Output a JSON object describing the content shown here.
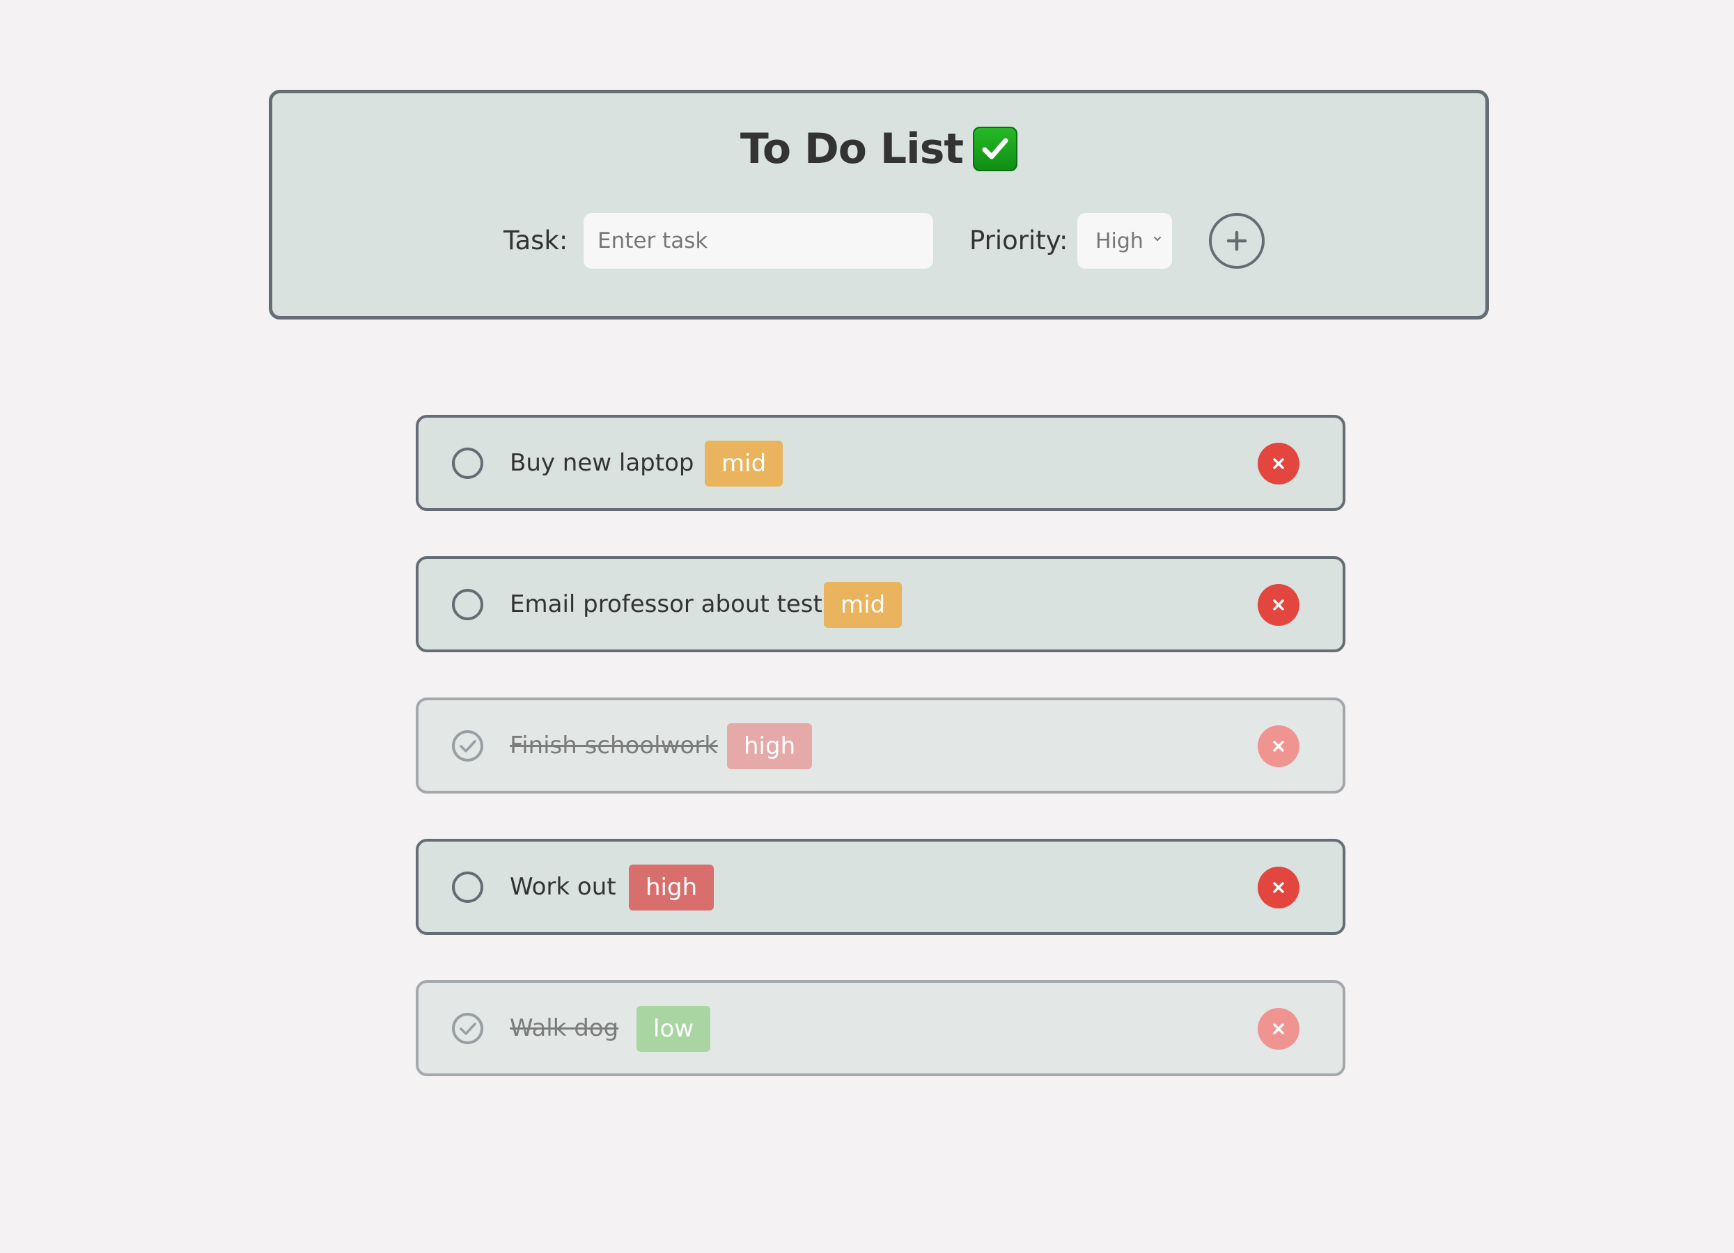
{
  "header": {
    "title": "To Do List",
    "title_icon": "check-mark-button-icon"
  },
  "form": {
    "task_label": "Task:",
    "task_placeholder": "Enter task",
    "task_value": "",
    "priority_label": "Priority:",
    "priority_selected": "High",
    "add_icon": "plus-icon"
  },
  "tasks": [
    {
      "text": "Buy new laptop",
      "priority": "mid",
      "completed": false
    },
    {
      "text": "Email professor about test",
      "priority": "mid",
      "completed": false
    },
    {
      "text": "Finish schoolwork",
      "priority": "high",
      "completed": true
    },
    {
      "text": "Work out",
      "priority": "high",
      "completed": false
    },
    {
      "text": "Walk dog",
      "priority": "low",
      "completed": true
    }
  ],
  "colors": {
    "background": "#f4f2f3",
    "card": "#d9e2de",
    "border": "#656d74",
    "mid": "#eab35e",
    "high": "#d86f6d",
    "low": "#a9d5a2",
    "delete": "#e2463e"
  }
}
